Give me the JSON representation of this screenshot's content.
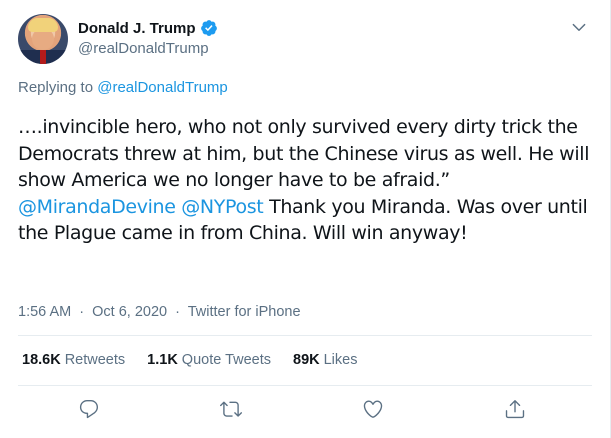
{
  "author": {
    "display_name": "Donald J. Trump",
    "handle": "@realDonaldTrump",
    "verified": true
  },
  "reply": {
    "prefix": "Replying to ",
    "to": "@realDonaldTrump"
  },
  "tweet": {
    "segments": [
      "….invincible hero, who not only survived every dirty trick the Democrats threw at him, but the Chinese virus as well. He will show America we no longer have to be afraid.” ",
      "@MirandaDevine",
      " ",
      "@NYPost",
      "  Thank you Miranda. Was over until the Plague came in from China. Will win anyway!"
    ]
  },
  "meta": {
    "time": "1:56 AM",
    "separator": "·",
    "date": "Oct 6, 2020",
    "source": "Twitter for iPhone"
  },
  "stats": {
    "retweets_count": "18.6K",
    "retweets_label": "Retweets",
    "quotes_count": "1.1K",
    "quotes_label": "Quote Tweets",
    "likes_count": "89K",
    "likes_label": "Likes"
  },
  "icons": {
    "verified": "verified-badge-icon",
    "more": "chevron-down-icon",
    "reply": "reply-icon",
    "retweet": "retweet-icon",
    "like": "heart-icon",
    "share": "share-icon"
  },
  "colors": {
    "link": "#1b95e0",
    "secondary_text": "#5b7083",
    "primary_text": "#0f1419",
    "divider": "#e6ecf0"
  }
}
